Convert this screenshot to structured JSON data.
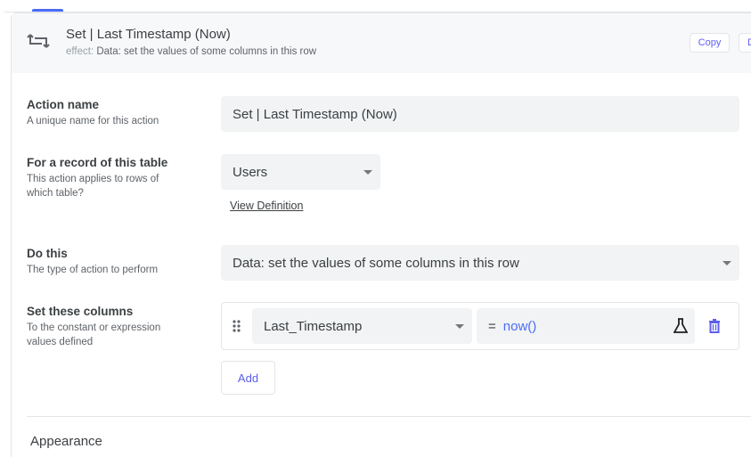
{
  "header": {
    "title": "Set | Last Timestamp (Now)",
    "effect_key": "effect:",
    "effect_value": "Data: set the values of some columns in this row",
    "copy_label": "Copy",
    "second_button_label": "D"
  },
  "form": {
    "action_name": {
      "label": "Action name",
      "description": "A unique name for this action",
      "value": "Set | Last Timestamp (Now)"
    },
    "table": {
      "label": "For a record of this table",
      "description": "This action applies to rows of which table?",
      "value": "Users",
      "view_definition": "View Definition"
    },
    "do_this": {
      "label": "Do this",
      "description": "The type of action to perform",
      "value": "Data: set the values of some columns in this row"
    },
    "set_columns": {
      "label": "Set these columns",
      "description": "To the constant or expression values defined",
      "rows": [
        {
          "column": "Last_Timestamp",
          "equals": "=",
          "expression": "now()"
        }
      ],
      "add_label": "Add"
    }
  },
  "section": {
    "appearance": "Appearance"
  },
  "colors": {
    "accent": "#5b5fef",
    "expression": "#4a6cf7"
  }
}
